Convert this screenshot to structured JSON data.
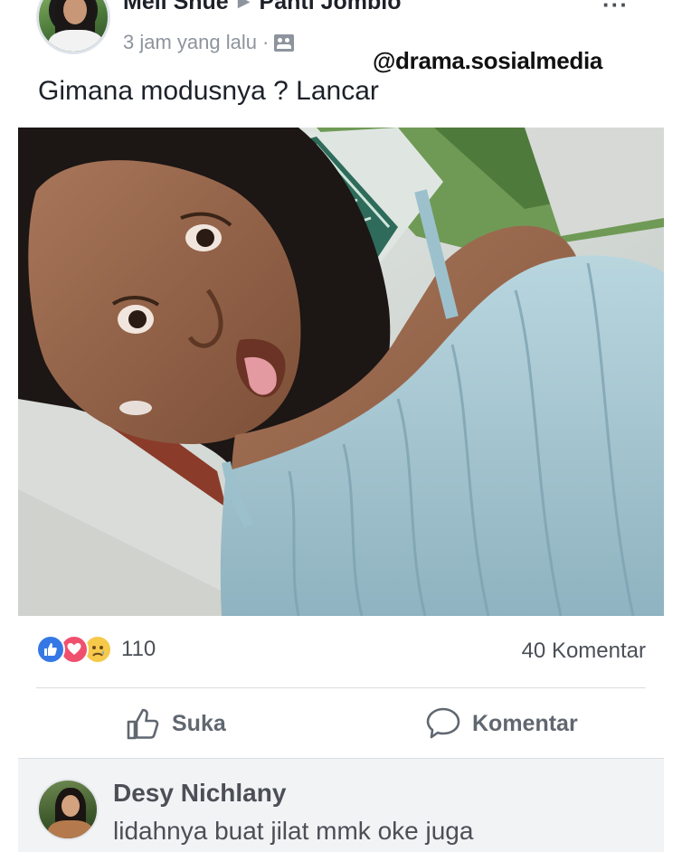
{
  "post": {
    "author": "Meli Shue",
    "group": "Panti Jomblo",
    "time": "3 jam yang lalu",
    "privacy_icon": "group-icon",
    "caption": "Gimana modusnya ? Lancar"
  },
  "watermark": "@drama.sosialmedia",
  "stats": {
    "reaction_icons": [
      "like-icon",
      "love-icon",
      "sad-icon"
    ],
    "reaction_count": "110",
    "comment_count": "40 Komentar"
  },
  "actions": {
    "like_label": "Suka",
    "comment_label": "Komentar"
  },
  "top_comment": {
    "author": "Desy Nichlany",
    "text": "lidahnya buat jilat mmk oke juga"
  },
  "colors": {
    "like_blue": "#3578e5",
    "love_red": "#f0506e",
    "sad_yellow": "#f7c94b",
    "text_dark": "#1d2129",
    "text_grey": "#606770"
  }
}
